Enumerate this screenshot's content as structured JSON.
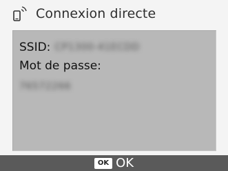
{
  "title": {
    "icon": "phone-wireless-icon",
    "text": "Connexion directe"
  },
  "panel": {
    "ssid_label": "SSID:",
    "ssid_value": "CP1300-41ECDD",
    "password_label": "Mot de passe:",
    "password_value": "76572266"
  },
  "footer": {
    "ok_key": "OK",
    "ok_label": "OK"
  },
  "colors": {
    "background": "#f4f4f4",
    "panel": "#b8b8b8",
    "footer": "#5a5a5a"
  }
}
